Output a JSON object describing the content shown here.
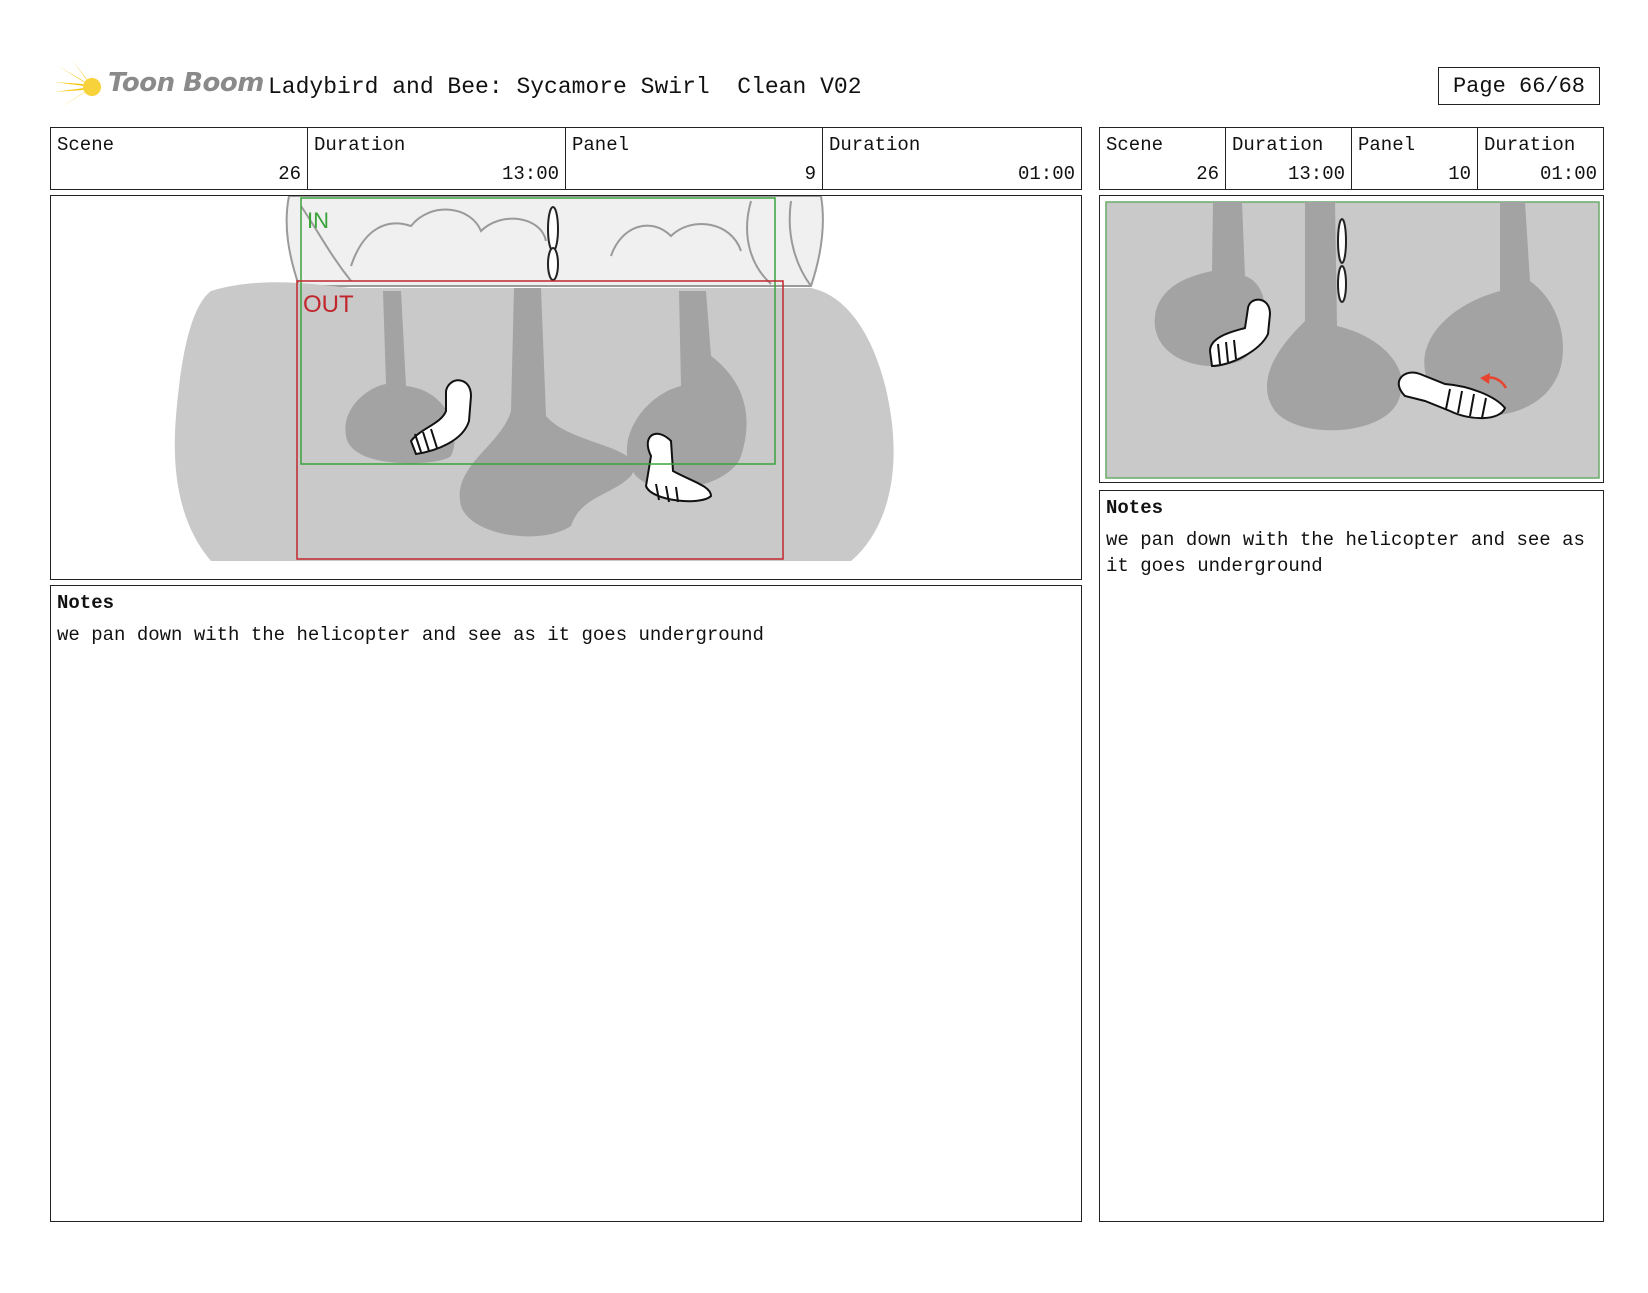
{
  "header": {
    "logo_text": "Toon Boom",
    "title": "Ladybird and Bee: Sycamore Swirl  Clean V02",
    "page": "Page 66/68"
  },
  "panel_left": {
    "scene_label": "Scene",
    "scene_value": "26",
    "duration_label": "Duration",
    "duration_value": "13:00",
    "panel_label": "Panel",
    "panel_value": "9",
    "panel_duration_label": "Duration",
    "panel_duration_value": "01:00",
    "in_label": "IN",
    "out_label": "OUT",
    "notes_label": "Notes",
    "notes_text": "we pan down with the helicopter and see as it goes underground"
  },
  "panel_right": {
    "scene_label": "Scene",
    "scene_value": "26",
    "duration_label": "Duration",
    "duration_value": "13:00",
    "panel_label": "Panel",
    "panel_value": "10",
    "panel_duration_label": "Duration",
    "panel_duration_value": "01:00",
    "notes_label": "Notes",
    "notes_text": "we pan down with the helicopter and see as it goes underground"
  },
  "colors": {
    "in_frame": "#3aa33a",
    "out_frame": "#c0272d",
    "soil": "#c9c9c9",
    "tunnel": "#a3a3a3",
    "arrow": "#e8432e",
    "logo_burst": "#f5c400"
  }
}
